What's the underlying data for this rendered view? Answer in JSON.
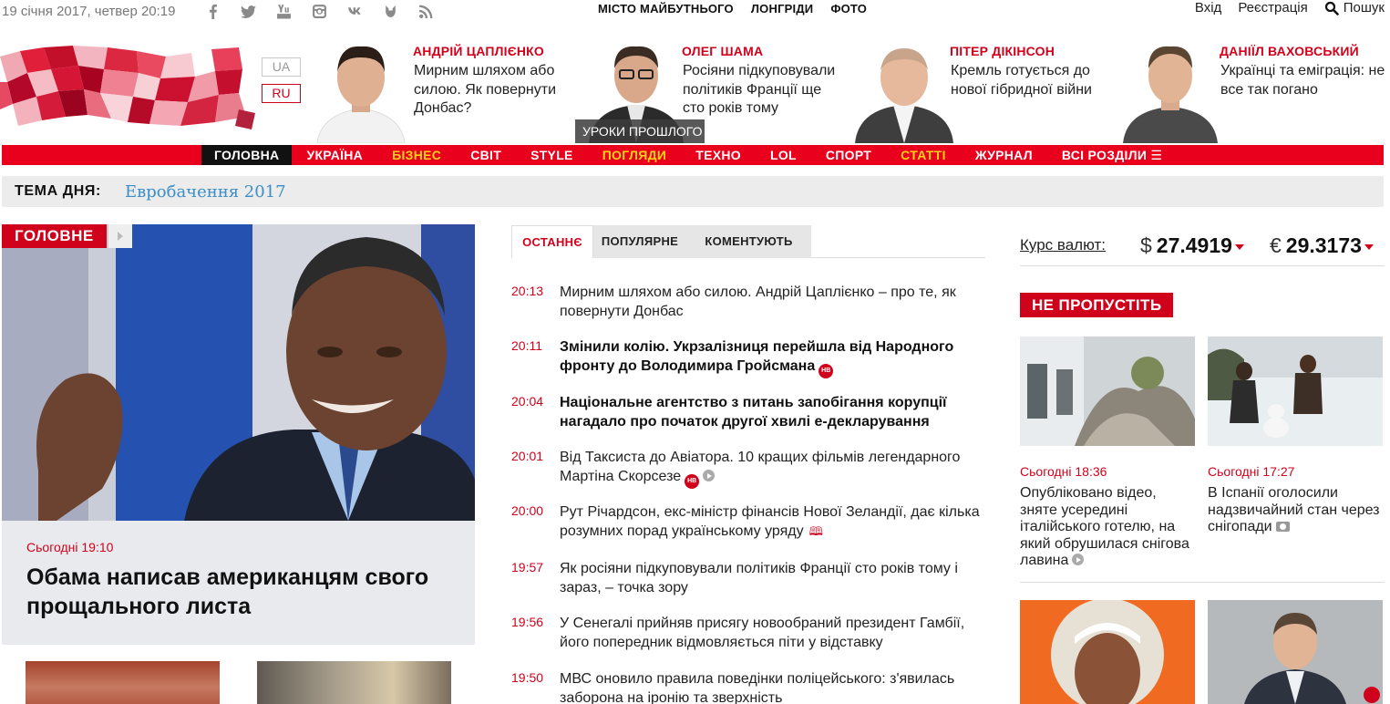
{
  "topbar": {
    "date": "19 січня 2017, четвер 20:19",
    "social_icons": [
      "facebook-icon",
      "twitter-icon",
      "youtube-icon",
      "instagram-icon",
      "vk-icon",
      "telegram-icon",
      "rss-icon"
    ],
    "specials": [
      "МІСТО МАЙБУТНЬОГО",
      "ЛОНГРІДИ",
      "ФОТО"
    ],
    "login": "Вхід",
    "register": "Реєстрація",
    "search": "Пошук"
  },
  "languages": {
    "ua": "UA",
    "ru": "RU"
  },
  "opinions": [
    {
      "name": "АНДРІЙ ЦАПЛІЄНКО",
      "quote": "Мирним шляхом або силою. Як повернути Донбас?"
    },
    {
      "name": "ОЛЕГ ШАМА",
      "quote": "Росіяни підкуповували політиків Франції ще сто років тому",
      "badge": "УРОКИ ПРОШЛОГО"
    },
    {
      "name": "ПІТЕР ДІКІНСОН",
      "quote": "Кремль готується до нової гібридної війни"
    },
    {
      "name": "ДАНІЇЛ ВАХОВСЬКИЙ",
      "quote": "Українці та еміграція: не все так погано"
    }
  ],
  "nav": {
    "items": [
      {
        "label": "ГОЛОВНА"
      },
      {
        "label": "УКРАЇНА"
      },
      {
        "label": "БІЗНЕС"
      },
      {
        "label": "СВІТ"
      },
      {
        "label": "STYLE"
      },
      {
        "label": "ПОГЛЯДИ"
      },
      {
        "label": "ТЕХНО"
      },
      {
        "label": "LOL"
      },
      {
        "label": "СПОРТ"
      },
      {
        "label": "СТАТТІ"
      },
      {
        "label": "ЖУРНАЛ"
      },
      {
        "label": "ВСІ РОЗДІЛИ ☰"
      }
    ],
    "accent_color": "#e8001c",
    "highlight_color": "#ffd21a"
  },
  "topic": {
    "label": "ТЕМА ДНЯ:",
    "link": "Евробачення 2017"
  },
  "feature": {
    "tag": "ГОЛОВНЕ",
    "time": "Сьогодні 19:10",
    "title": "Обама написав американцям свого прощального листа"
  },
  "tabs": [
    "ОСТАННЄ",
    "ПОПУЛЯРНЕ",
    "КОМЕНТУЮТЬ"
  ],
  "news": [
    {
      "time": "20:13",
      "title": "Мирним шляхом або силою. Андрій Цаплієнко – про те, як повернути Донбас"
    },
    {
      "time": "20:11",
      "title": "Змінили колію. Укрзалізниця перейшла від Народного фронту до Володимира Гройсмана"
    },
    {
      "time": "20:04",
      "title": "Національне агентство з питань запобігання корупції нагадало про початок другої хвилі е-декларування"
    },
    {
      "time": "20:01",
      "title": "Від Таксиста до Авіатора. 10 кращих фільмів легендарного Мартіна Скорсезе"
    },
    {
      "time": "20:00",
      "title": "Рут Річардсон, екс-міністр фінансів Нової Зеландії, дає кілька розумних порад українському уряду"
    },
    {
      "time": "19:57",
      "title": "Як росіяни підкуповували політиків Франції сто років тому і зараз, – точка зору"
    },
    {
      "time": "19:56",
      "title": "У Сенегалі прийняв присягу новообраний президент Гамбії, його попередник відмовляється піти у відставку"
    },
    {
      "time": "19:50",
      "title": "МВС оновило правила поведінки поліцейського: з'явилась заборона на іронію та зверхність"
    }
  ],
  "nv_badge": "НВ",
  "rates": {
    "label": "Курс валют:",
    "usd_symbol": "$",
    "usd": "27.4919",
    "eur_symbol": "€",
    "eur": "29.3173"
  },
  "dont_miss": {
    "title": "НЕ ПРОПУСТІТЬ",
    "cards": [
      {
        "time": "Сьогодні 18:36",
        "title": "Опубліковано відео, зняте усередині італійського готелю, на який обрушилася снігова лавина"
      },
      {
        "time": "Сьогодні 17:27",
        "title": "В Іспанії оголосили надзвичайний стан через снігопади"
      }
    ]
  }
}
